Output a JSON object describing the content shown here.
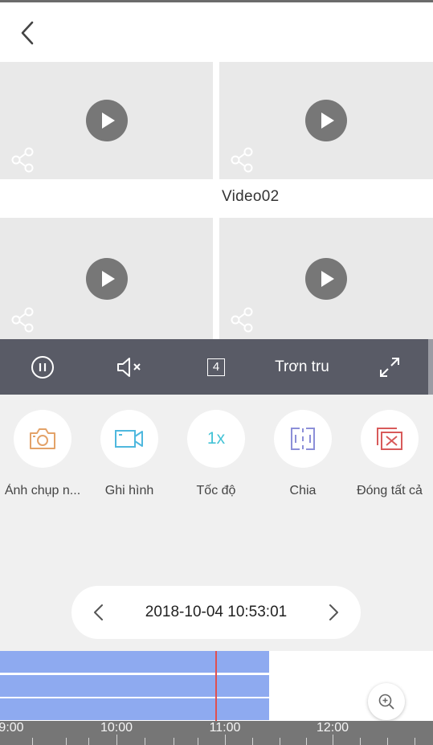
{
  "header": {
    "back_icon": "chevron-left-icon"
  },
  "videos": [
    {
      "label": ""
    },
    {
      "label": "Video02"
    },
    {
      "label": ""
    },
    {
      "label": ""
    }
  ],
  "controls": {
    "pause_icon": "pause-circle-icon",
    "mute_icon": "speaker-muted-icon",
    "layout_count": "4",
    "quality": "Trơn tru",
    "fullscreen_icon": "expand-icon"
  },
  "actions": [
    {
      "label": "Ảnh chụp n...",
      "icon": "camera-icon",
      "color": "#e3a268"
    },
    {
      "label": "Ghi hình",
      "icon": "video-camera-icon",
      "color": "#4fb8de"
    },
    {
      "label": "Tốc độ",
      "icon": "speed-icon",
      "text": "1x",
      "color": "#44c3d6"
    },
    {
      "label": "Chia",
      "icon": "split-icon",
      "color": "#8c8fd8"
    },
    {
      "label": "Đóng tất cả",
      "icon": "close-all-icon",
      "color": "#d85a5a"
    }
  ],
  "playback": {
    "datetime": "2018-10-04 10:53:01"
  },
  "timeline": {
    "labels": [
      "9:00",
      "10:00",
      "11:00",
      "12:00"
    ]
  },
  "colors": {
    "control_bar": "#595b66",
    "recording": "#8eaaf0",
    "playhead": "#e05050"
  }
}
